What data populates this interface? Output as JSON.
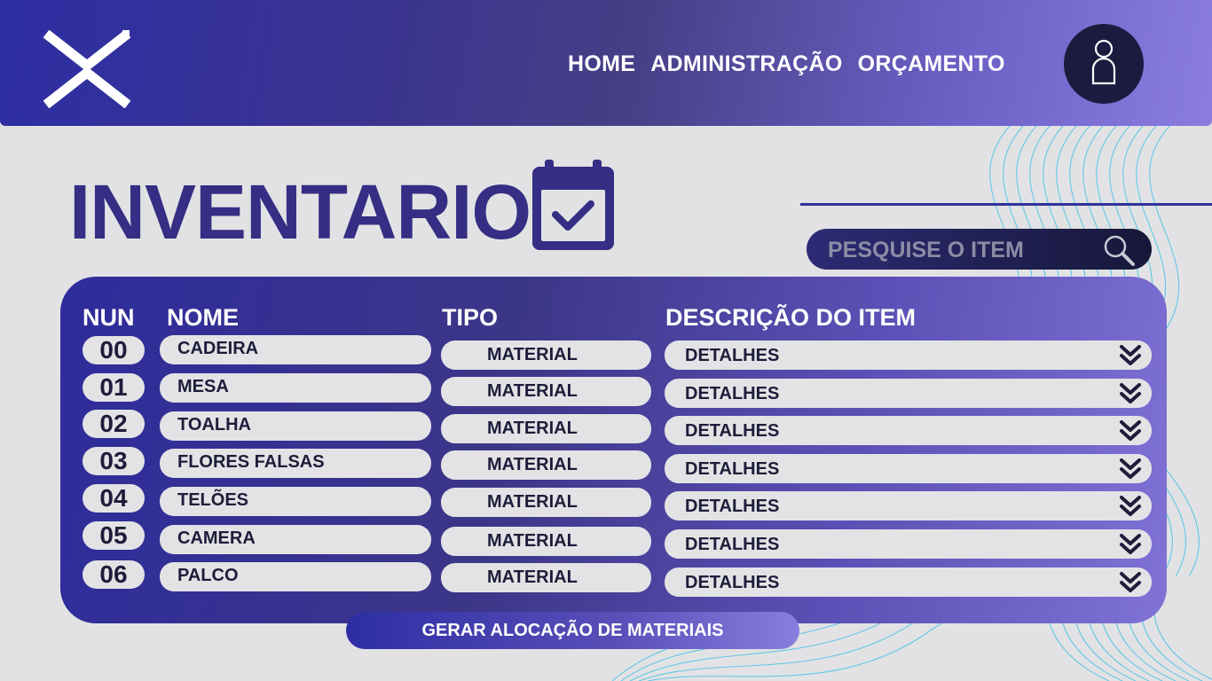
{
  "header": {
    "nav": [
      "HOME",
      "ADMINISTRAÇÃO",
      "ORÇAMENTO"
    ]
  },
  "page": {
    "title": "INVENTARIO"
  },
  "search": {
    "placeholder": "PESQUISE O ITEM"
  },
  "table": {
    "columns": [
      "NUN",
      "NOME",
      "TIPO",
      "DESCRIÇÃO DO ITEM"
    ],
    "rows": [
      {
        "num": "00",
        "name": "CADEIRA",
        "type": "MATERIAL",
        "desc": "DETALHES"
      },
      {
        "num": "01",
        "name": "MESA",
        "type": "MATERIAL",
        "desc": "DETALHES"
      },
      {
        "num": "02",
        "name": "TOALHA",
        "type": "MATERIAL",
        "desc": "DETALHES"
      },
      {
        "num": "03",
        "name": "FLORES FALSAS",
        "type": "MATERIAL",
        "desc": "DETALHES"
      },
      {
        "num": "04",
        "name": "TELÕES",
        "type": "MATERIAL",
        "desc": "DETALHES"
      },
      {
        "num": "05",
        "name": "CAMERA",
        "type": "MATERIAL",
        "desc": "DETALHES"
      },
      {
        "num": "06",
        "name": "PALCO",
        "type": "MATERIAL",
        "desc": "DETALHES"
      }
    ]
  },
  "actions": {
    "generate": "GERAR ALOCAÇÃO DE MATERIAIS"
  },
  "colors": {
    "primary": "#2d2ea4",
    "title": "#352e84",
    "pill": "#e3e3e6",
    "accent": "#8b7de0",
    "wave": "#4ec3e6"
  },
  "icons": [
    "logo-icon",
    "user-icon",
    "calendar-check-icon",
    "search-icon",
    "chevron-double-down-icon"
  ]
}
